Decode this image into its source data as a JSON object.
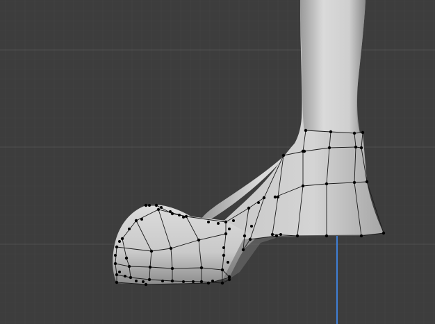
{
  "viewport": {
    "mode": "edit-mode-side-view",
    "background_color": "#3d3d3d",
    "grid_minor_color": "#454545",
    "grid_major_color": "#505050",
    "axis_color": "#3f7fd6",
    "mesh_shade_light": "#d6d6d6",
    "mesh_shade_dark": "#8e8e8e",
    "wire_color": "#1a1a1a",
    "vertex_color": "#000000",
    "object": "leg-with-shoe-mesh"
  }
}
